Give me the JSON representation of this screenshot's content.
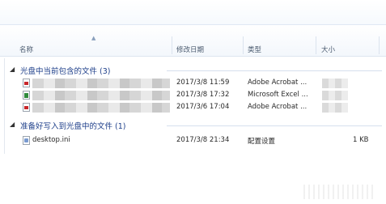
{
  "columns": [
    {
      "label": "名称"
    },
    {
      "label": "修改日期"
    },
    {
      "label": "类型"
    },
    {
      "label": "大小"
    }
  ],
  "groups": [
    {
      "title": "光盘中当前包含的文件 (3)",
      "files": [
        {
          "icon": "pdf-icon",
          "name": "",
          "date": "2017/3/8 11:59",
          "type": "Adobe Acrobat ...",
          "size": ""
        },
        {
          "icon": "excel-icon",
          "name": "",
          "date": "2017/3/8 17:32",
          "type": "Microsoft Excel ...",
          "size": ""
        },
        {
          "icon": "pdf-icon",
          "name": "",
          "date": "2017/3/6 17:04",
          "type": "Adobe Acrobat ...",
          "size": ""
        }
      ]
    },
    {
      "title": "准备好写入到光盘中的文件 (1)",
      "files": [
        {
          "icon": "settings-file-icon",
          "name": "desktop.ini",
          "date": "2017/3/8 21:34",
          "type": "配置设置",
          "size": "1 KB"
        }
      ]
    }
  ]
}
